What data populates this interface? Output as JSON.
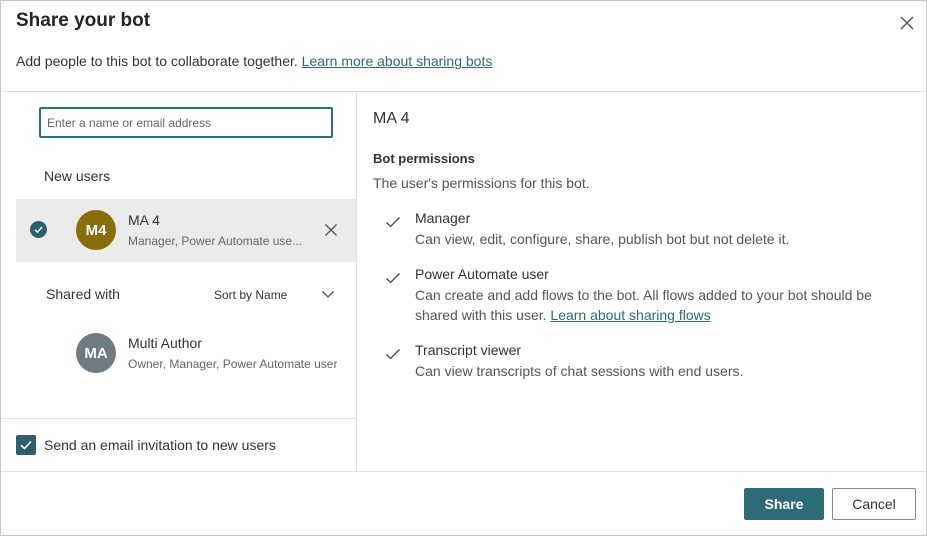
{
  "dialog": {
    "title": "Share your bot",
    "subtitle": "Add people to this bot to collaborate together. ",
    "subtitle_link": "Learn more about sharing bots",
    "close_icon": "close-icon"
  },
  "left": {
    "search_placeholder": "Enter a name or email address",
    "new_users_label": "New users",
    "new_users": [
      {
        "initials": "M4",
        "name": "MA 4",
        "role": "Manager, Power Automate use...",
        "avatar_color": "#8a6d0b",
        "selected": true
      }
    ],
    "shared_with_label": "Shared with",
    "sort_label": "Sort by Name",
    "shared_with": [
      {
        "initials": "MA",
        "name": "Multi Author",
        "role": "Owner, Manager, Power Automate user",
        "avatar_color": "#6e7b83"
      }
    ],
    "email_invite_label": "Send an email invitation to new users",
    "email_invite_checked": true
  },
  "right": {
    "user_title": "MA 4",
    "permissions_heading": "Bot permissions",
    "permissions_sub": "The user's permissions for this bot.",
    "permissions": [
      {
        "name": "Manager",
        "desc": "Can view, edit, configure, share, publish bot but not delete it.",
        "link": ""
      },
      {
        "name": "Power Automate user",
        "desc": "Can create and add flows to the bot. All flows added to your bot should be shared with this user. ",
        "link": "Learn about sharing flows"
      },
      {
        "name": "Transcript viewer",
        "desc": "Can view transcripts of chat sessions with end users.",
        "link": ""
      }
    ]
  },
  "footer": {
    "share_label": "Share",
    "cancel_label": "Cancel"
  },
  "colors": {
    "accent": "#2e6b78",
    "link": "#2b6a76",
    "selected_row": "#ebebeb"
  }
}
